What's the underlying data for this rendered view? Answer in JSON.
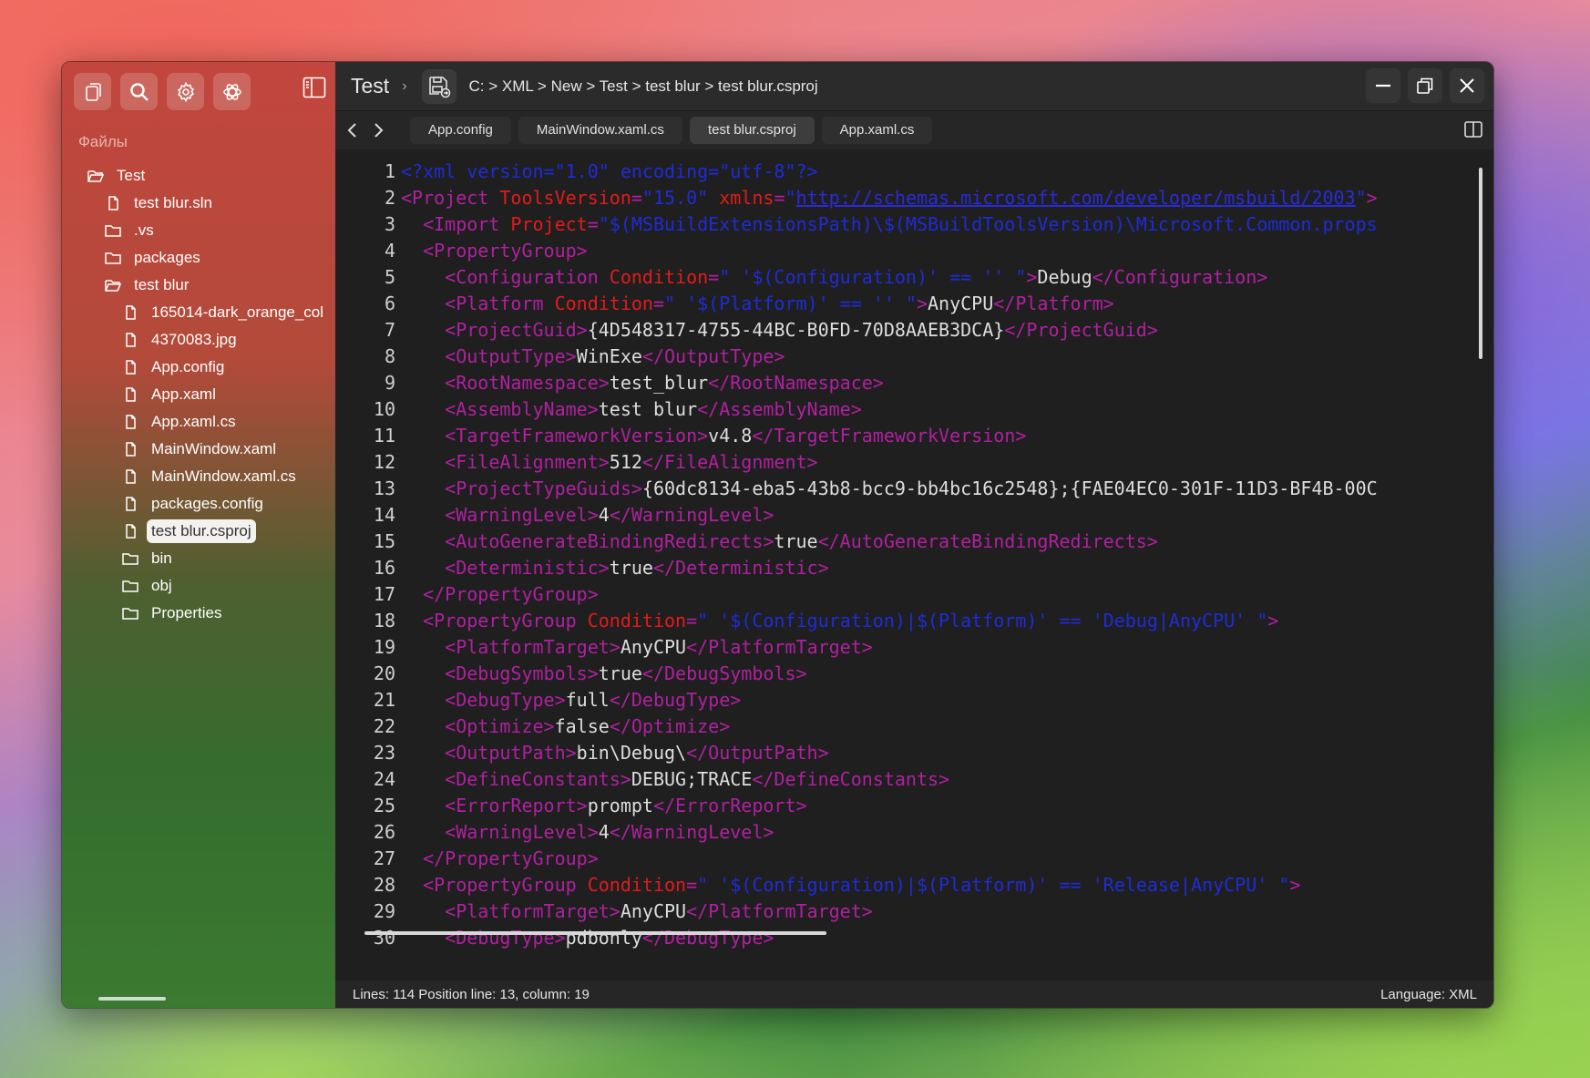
{
  "sidebar": {
    "files_label": "Файлы",
    "tree": [
      {
        "label": "Test",
        "type": "folder-open",
        "depth": 0
      },
      {
        "label": "test blur.sln",
        "type": "file",
        "depth": 1
      },
      {
        "label": ".vs",
        "type": "folder",
        "depth": 1
      },
      {
        "label": "packages",
        "type": "folder",
        "depth": 1
      },
      {
        "label": "test blur",
        "type": "folder-open",
        "depth": 1
      },
      {
        "label": "165014-dark_orange_col",
        "type": "file",
        "depth": 2
      },
      {
        "label": "4370083.jpg",
        "type": "file",
        "depth": 2
      },
      {
        "label": "App.config",
        "type": "file",
        "depth": 2
      },
      {
        "label": "App.xaml",
        "type": "file",
        "depth": 2
      },
      {
        "label": "App.xaml.cs",
        "type": "file",
        "depth": 2
      },
      {
        "label": "MainWindow.xaml",
        "type": "file",
        "depth": 2
      },
      {
        "label": "MainWindow.xaml.cs",
        "type": "file",
        "depth": 2
      },
      {
        "label": "packages.config",
        "type": "file",
        "depth": 2
      },
      {
        "label": "test blur.csproj",
        "type": "file",
        "depth": 2,
        "selected": true
      },
      {
        "label": "bin",
        "type": "folder",
        "depth": 2
      },
      {
        "label": "obj",
        "type": "folder",
        "depth": 2
      },
      {
        "label": "Properties",
        "type": "folder",
        "depth": 2
      }
    ]
  },
  "header": {
    "project_title": "Test",
    "breadcrumb": "C: > XML > New > Test > test blur > test blur.csproj"
  },
  "tabs": [
    {
      "label": "App.config",
      "active": false
    },
    {
      "label": "MainWindow.xaml.cs",
      "active": false
    },
    {
      "label": "test blur.csproj",
      "active": true
    },
    {
      "label": "App.xaml.cs",
      "active": false
    }
  ],
  "editor": {
    "lines": [
      [
        [
          "pi",
          "<?xml version=\"1.0\" encoding=\"utf-8\"?>"
        ]
      ],
      [
        [
          "tag",
          "<Project "
        ],
        [
          "attr",
          "ToolsVersion"
        ],
        [
          "tag",
          "="
        ],
        [
          "val",
          "\"15.0\" "
        ],
        [
          "attr",
          "xmlns"
        ],
        [
          "tag",
          "="
        ],
        [
          "val",
          "\""
        ],
        [
          "link",
          "http://schemas.microsoft.com/developer/msbuild/2003"
        ],
        [
          "val",
          "\""
        ],
        [
          "tag",
          ">"
        ]
      ],
      [
        [
          "txt",
          "  "
        ],
        [
          "tag",
          "<Import "
        ],
        [
          "attr",
          "Project"
        ],
        [
          "tag",
          "="
        ],
        [
          "val",
          "\"$(MSBuildExtensionsPath)\\$(MSBuildToolsVersion)\\Microsoft.Common.props"
        ]
      ],
      [
        [
          "txt",
          "  "
        ],
        [
          "tag",
          "<PropertyGroup>"
        ]
      ],
      [
        [
          "txt",
          "    "
        ],
        [
          "tag",
          "<Configuration "
        ],
        [
          "attr",
          "Condition"
        ],
        [
          "tag",
          "="
        ],
        [
          "val",
          "\" '$(Configuration)' == '' \""
        ],
        [
          "tag",
          ">"
        ],
        [
          "txt",
          "Debug"
        ],
        [
          "tag",
          "</Configuration>"
        ]
      ],
      [
        [
          "txt",
          "    "
        ],
        [
          "tag",
          "<Platform "
        ],
        [
          "attr",
          "Condition"
        ],
        [
          "tag",
          "="
        ],
        [
          "val",
          "\" '$(Platform)' == '' \""
        ],
        [
          "tag",
          ">"
        ],
        [
          "txt",
          "AnyCPU"
        ],
        [
          "tag",
          "</Platform>"
        ]
      ],
      [
        [
          "txt",
          "    "
        ],
        [
          "tag",
          "<ProjectGuid>"
        ],
        [
          "txt",
          "{4D548317-4755-44BC-B0FD-70D8AAEB3DCA}"
        ],
        [
          "tag",
          "</ProjectGuid>"
        ]
      ],
      [
        [
          "txt",
          "    "
        ],
        [
          "tag",
          "<OutputType>"
        ],
        [
          "txt",
          "WinExe"
        ],
        [
          "tag",
          "</OutputType>"
        ]
      ],
      [
        [
          "txt",
          "    "
        ],
        [
          "tag",
          "<RootNamespace>"
        ],
        [
          "txt",
          "test_blur"
        ],
        [
          "tag",
          "</RootNamespace>"
        ]
      ],
      [
        [
          "txt",
          "    "
        ],
        [
          "tag",
          "<AssemblyName>"
        ],
        [
          "txt",
          "test blur"
        ],
        [
          "tag",
          "</AssemblyName>"
        ]
      ],
      [
        [
          "txt",
          "    "
        ],
        [
          "tag",
          "<TargetFrameworkVersion>"
        ],
        [
          "txt",
          "v4.8"
        ],
        [
          "tag",
          "</TargetFrameworkVersion>"
        ]
      ],
      [
        [
          "txt",
          "    "
        ],
        [
          "tag",
          "<FileAlignment>"
        ],
        [
          "txt",
          "512"
        ],
        [
          "tag",
          "</FileAlignment>"
        ]
      ],
      [
        [
          "txt",
          "    "
        ],
        [
          "tag",
          "<ProjectTypeGuids>"
        ],
        [
          "txt",
          "{60dc8134-eba5-43b8-bcc9-bb4bc16c2548};{FAE04EC0-301F-11D3-BF4B-00C"
        ]
      ],
      [
        [
          "txt",
          "    "
        ],
        [
          "tag",
          "<WarningLevel>"
        ],
        [
          "txt",
          "4"
        ],
        [
          "tag",
          "</WarningLevel>"
        ]
      ],
      [
        [
          "txt",
          "    "
        ],
        [
          "tag",
          "<AutoGenerateBindingRedirects>"
        ],
        [
          "txt",
          "true"
        ],
        [
          "tag",
          "</AutoGenerateBindingRedirects>"
        ]
      ],
      [
        [
          "txt",
          "    "
        ],
        [
          "tag",
          "<Deterministic>"
        ],
        [
          "txt",
          "true"
        ],
        [
          "tag",
          "</Deterministic>"
        ]
      ],
      [
        [
          "txt",
          "  "
        ],
        [
          "tag",
          "</PropertyGroup>"
        ]
      ],
      [
        [
          "txt",
          "  "
        ],
        [
          "tag",
          "<PropertyGroup "
        ],
        [
          "attr",
          "Condition"
        ],
        [
          "tag",
          "="
        ],
        [
          "val",
          "\" '$(Configuration)|$(Platform)' == 'Debug|AnyCPU' \""
        ],
        [
          "tag",
          ">"
        ]
      ],
      [
        [
          "txt",
          "    "
        ],
        [
          "tag",
          "<PlatformTarget>"
        ],
        [
          "txt",
          "AnyCPU"
        ],
        [
          "tag",
          "</PlatformTarget>"
        ]
      ],
      [
        [
          "txt",
          "    "
        ],
        [
          "tag",
          "<DebugSymbols>"
        ],
        [
          "txt",
          "true"
        ],
        [
          "tag",
          "</DebugSymbols>"
        ]
      ],
      [
        [
          "txt",
          "    "
        ],
        [
          "tag",
          "<DebugType>"
        ],
        [
          "txt",
          "full"
        ],
        [
          "tag",
          "</DebugType>"
        ]
      ],
      [
        [
          "txt",
          "    "
        ],
        [
          "tag",
          "<Optimize>"
        ],
        [
          "txt",
          "false"
        ],
        [
          "tag",
          "</Optimize>"
        ]
      ],
      [
        [
          "txt",
          "    "
        ],
        [
          "tag",
          "<OutputPath>"
        ],
        [
          "txt",
          "bin\\Debug\\"
        ],
        [
          "tag",
          "</OutputPath>"
        ]
      ],
      [
        [
          "txt",
          "    "
        ],
        [
          "tag",
          "<DefineConstants>"
        ],
        [
          "txt",
          "DEBUG;TRACE"
        ],
        [
          "tag",
          "</DefineConstants>"
        ]
      ],
      [
        [
          "txt",
          "    "
        ],
        [
          "tag",
          "<ErrorReport>"
        ],
        [
          "txt",
          "prompt"
        ],
        [
          "tag",
          "</ErrorReport>"
        ]
      ],
      [
        [
          "txt",
          "    "
        ],
        [
          "tag",
          "<WarningLevel>"
        ],
        [
          "txt",
          "4"
        ],
        [
          "tag",
          "</WarningLevel>"
        ]
      ],
      [
        [
          "txt",
          "  "
        ],
        [
          "tag",
          "</PropertyGroup>"
        ]
      ],
      [
        [
          "txt",
          "  "
        ],
        [
          "tag",
          "<PropertyGroup "
        ],
        [
          "attr",
          "Condition"
        ],
        [
          "tag",
          "="
        ],
        [
          "val",
          "\" '$(Configuration)|$(Platform)' == 'Release|AnyCPU' \""
        ],
        [
          "tag",
          ">"
        ]
      ],
      [
        [
          "txt",
          "    "
        ],
        [
          "tag",
          "<PlatformTarget>"
        ],
        [
          "txt",
          "AnyCPU"
        ],
        [
          "tag",
          "</PlatformTarget>"
        ]
      ],
      [
        [
          "txt",
          "    "
        ],
        [
          "tag",
          "<DebugType>"
        ],
        [
          "txt",
          "pdbonly"
        ],
        [
          "tag",
          "</DebugType>"
        ]
      ]
    ]
  },
  "status": {
    "left": "Lines: 114  Position line: 13, column: 19",
    "right": "Language: XML"
  }
}
